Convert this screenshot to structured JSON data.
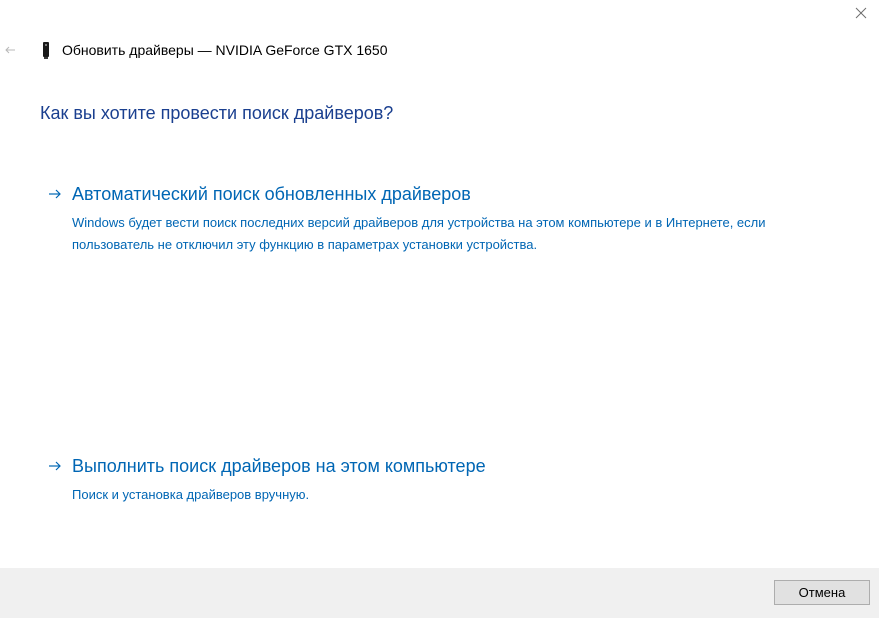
{
  "window": {
    "title": "Обновить драйверы — NVIDIA GeForce GTX 1650",
    "close_icon": "close-icon",
    "back_icon": "back-arrow-icon",
    "device_icon": "gpu-device-icon"
  },
  "question": "Как вы хотите провести поиск драйверов?",
  "options": [
    {
      "title": "Автоматический поиск обновленных драйверов",
      "description": "Windows будет вести поиск последних версий драйверов для устройства на этом компьютере и в Интернете, если пользователь не отключил эту функцию в параметрах установки устройства.",
      "icon": "arrow-right-icon"
    },
    {
      "title": "Выполнить поиск драйверов на этом компьютере",
      "description": "Поиск и установка драйверов вручную.",
      "icon": "arrow-right-icon"
    }
  ],
  "footer": {
    "cancel_label": "Отмена"
  },
  "colors": {
    "question": "#1a3f8f",
    "link": "#0066b4",
    "footer_bg": "#f0f0f0"
  }
}
